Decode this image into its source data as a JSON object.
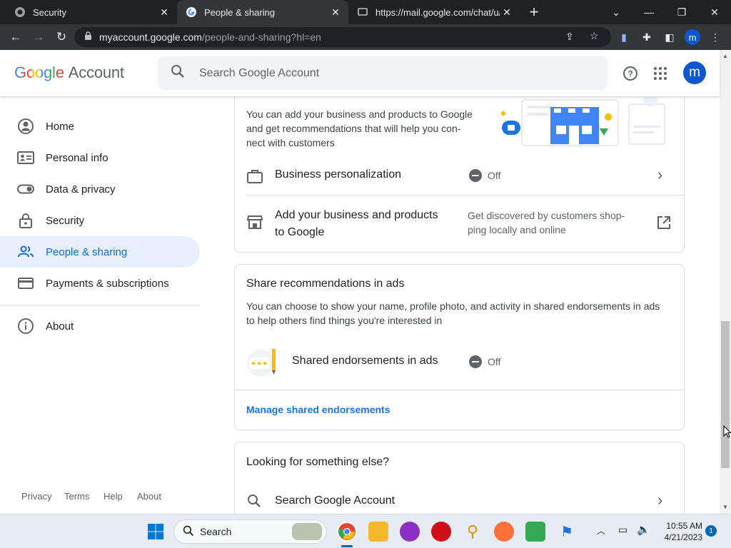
{
  "browser": {
    "tabs": [
      {
        "title": "Security",
        "favicon": "google-g-icon",
        "active": false
      },
      {
        "title": "People & sharing",
        "favicon": "google-g-icon",
        "active": true
      },
      {
        "title": "https://mail.google.com/chat/u/0",
        "favicon": "chat-icon",
        "active": false
      }
    ],
    "new_tab": "+",
    "url_host": "myaccount.google.com",
    "url_path": "/people-and-sharing?hl=en",
    "profile_initial": "m"
  },
  "header": {
    "logo_google": "Google",
    "logo_account": "Account",
    "search_placeholder": "Search Google Account",
    "avatar_initial": "m"
  },
  "sidebar": {
    "items": [
      {
        "label": "Home",
        "icon": "home-icon"
      },
      {
        "label": "Personal info",
        "icon": "id-card-icon"
      },
      {
        "label": "Data & privacy",
        "icon": "toggle-icon"
      },
      {
        "label": "Security",
        "icon": "lock-icon"
      },
      {
        "label": "People & sharing",
        "icon": "people-icon",
        "selected": true
      },
      {
        "label": "Payments & subscriptions",
        "icon": "credit-card-icon"
      },
      {
        "label": "About",
        "icon": "info-icon"
      }
    ],
    "footer": [
      "Privacy",
      "Terms",
      "Help",
      "About"
    ]
  },
  "business_card": {
    "description": "You can add your business and products to Google and get recommendations that will help you con-nect with customers",
    "desc_line1": "You can add your business and products to Google",
    "desc_line2": "and get recommendations that will help you con-",
    "desc_line3": "nect with customers",
    "personalization_label": "Business personalization",
    "personalization_status": "Off",
    "add_label_line1": "Add your business and products",
    "add_label_line2": "to Google",
    "add_desc_line1": "Get discovered by customers shop-",
    "add_desc_line2": "ping locally and online"
  },
  "ads_card": {
    "title": "Share recommendations in ads",
    "desc_line1": "You can choose to show your name, profile photo, and activity in shared endorsements in ads",
    "desc_line2": "to help others find things you're interested in",
    "endorsement_label": "Shared endorsements in ads",
    "endorsement_status": "Off",
    "manage_link": "Manage shared endorsements"
  },
  "else_card": {
    "title": "Looking for something else?",
    "search_label": "Search Google Account"
  },
  "taskbar": {
    "search_label": "Search",
    "time": "10:55 AM",
    "date": "4/21/2023",
    "notification_count": "1"
  },
  "colors": {
    "accent": "#1a73e8",
    "selected_bg": "#e8f0fe",
    "avatar": "#0b57d0"
  }
}
